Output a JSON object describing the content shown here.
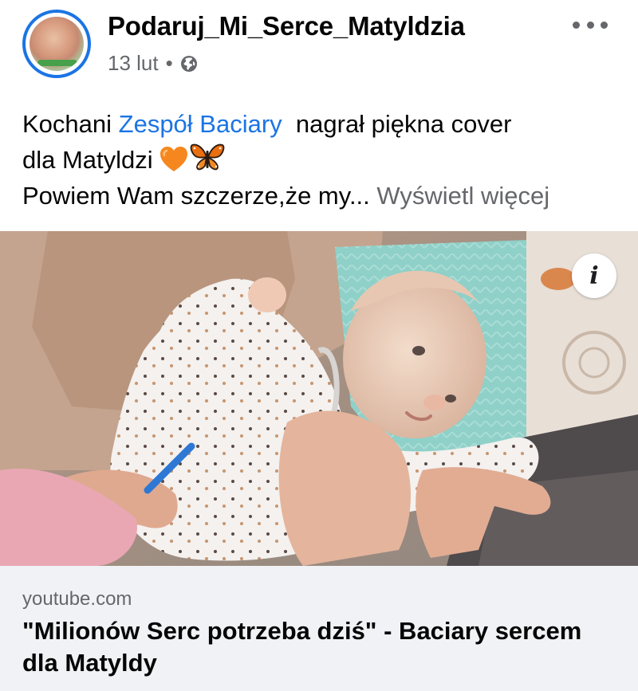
{
  "post": {
    "author": "Podaruj_Mi_Serce_Matyldzia",
    "date": "13 lut",
    "separator": "•",
    "privacy_icon": "globe-icon",
    "more_icon": "more-options-icon",
    "text": {
      "line1_prefix": "Kochani ",
      "mention": "Zespół Baciary",
      "line1_suffix": "  nagrał piękna cover",
      "line2": "dla Matyldzi ",
      "line2_emojis": [
        "orange-heart-icon",
        "butterfly-icon"
      ],
      "line3": "Powiem Wam szczerze,że my...",
      "see_more": " Wyświetl więcej"
    }
  },
  "link_preview": {
    "image_alt": "baby-photo",
    "info_icon": "info-icon",
    "info_glyph": "i",
    "domain": "youtube.com",
    "title": "\"Milionów Serc potrzeba dziś\" - Baciary sercem dla Matyldy"
  },
  "colors": {
    "accent": "#1b74e4",
    "secondary_text": "#65676b",
    "link_footer_bg": "#f0f2f5"
  }
}
